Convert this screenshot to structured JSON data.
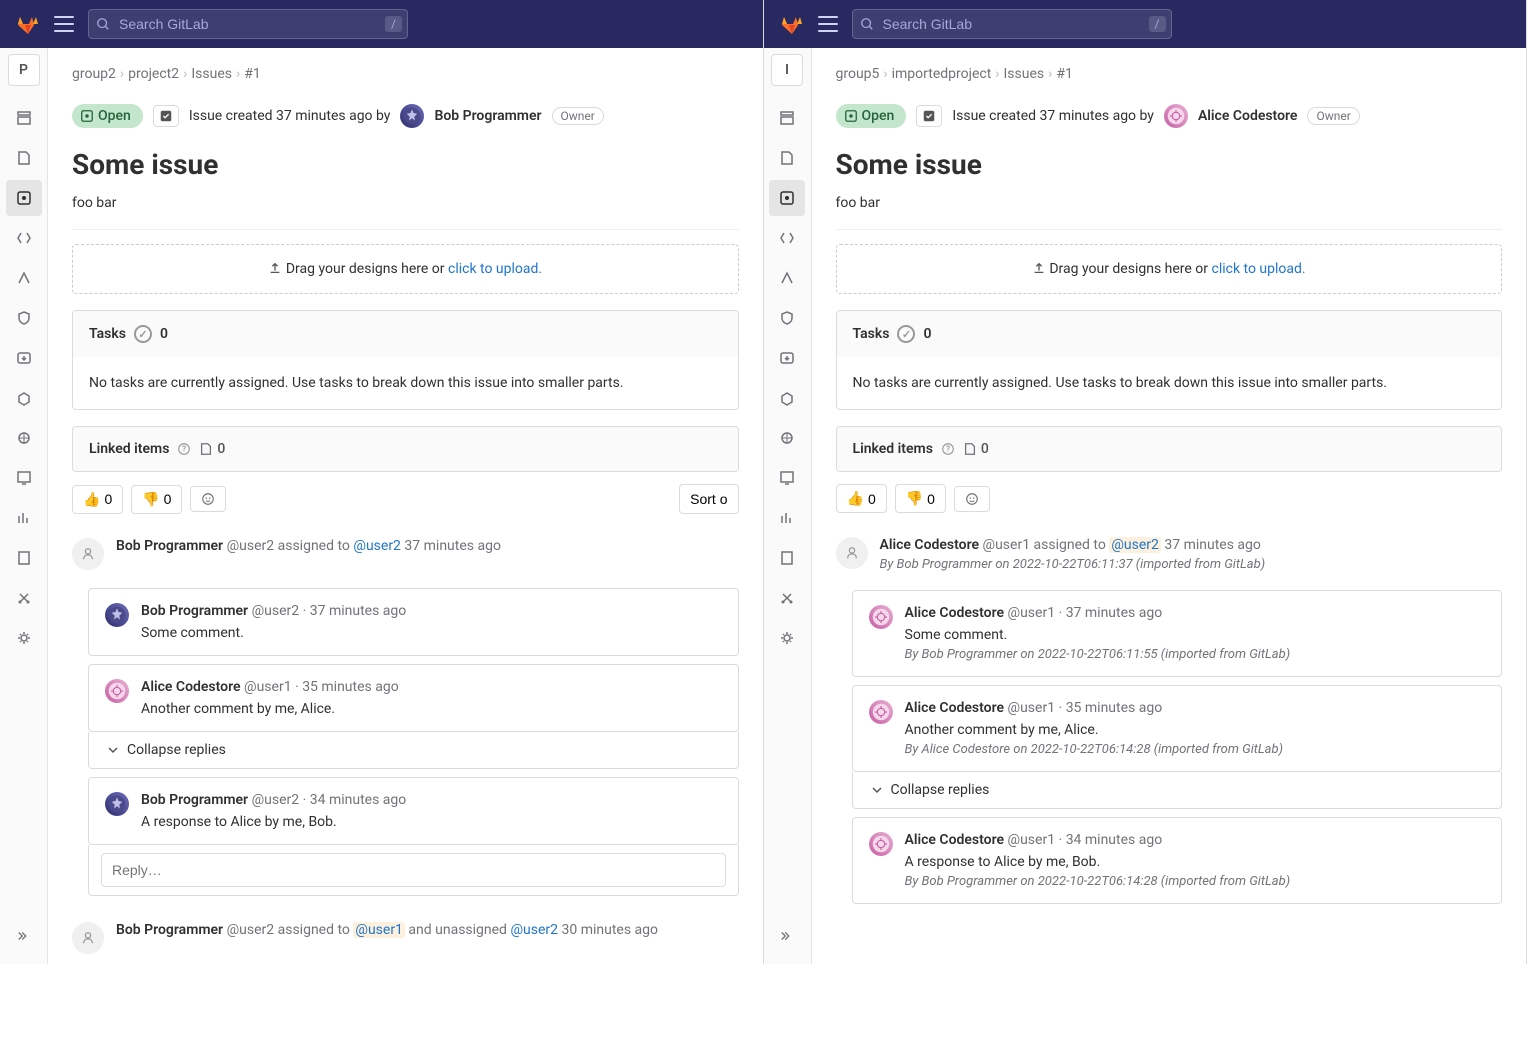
{
  "search_placeholder": "Search GitLab",
  "slash_key": "/",
  "panes": [
    {
      "project_initial": "P",
      "breadcrumbs": [
        "group2",
        "project2",
        "Issues",
        "#1"
      ],
      "status": "Open",
      "created_prefix": "Issue created 37 minutes ago by",
      "author": {
        "name": "Bob Programmer",
        "avatar": "bob"
      },
      "role": "Owner",
      "title": "Some issue",
      "desc": "foo bar",
      "upload_text": "Drag your designs here or ",
      "upload_link": "click to upload.",
      "tasks_label": "Tasks",
      "tasks_count": "0",
      "tasks_empty": "No tasks are currently assigned. Use tasks to break down this issue into smaller parts.",
      "linked_label": "Linked items",
      "linked_count": "0",
      "thumbs_up": "0",
      "thumbs_down": "0",
      "sort_label": "Sort o",
      "timeline": [
        {
          "type": "sys",
          "name": "Bob Programmer",
          "handle": "@user2",
          "text": " assigned to ",
          "mention": "@user2",
          "time": "37 minutes ago"
        },
        {
          "type": "note",
          "avatar": "bob",
          "name": "Bob Programmer",
          "handle": "@user2",
          "time": "37 minutes ago",
          "body": "Some comment."
        },
        {
          "type": "note",
          "avatar": "alice",
          "name": "Alice Codestore",
          "handle": "@user1",
          "time": "35 minutes ago",
          "body": "Another comment by me, Alice."
        },
        {
          "type": "collapse",
          "label": "Collapse replies"
        },
        {
          "type": "note",
          "avatar": "bob",
          "name": "Bob Programmer",
          "handle": "@user2",
          "time": "34 minutes ago",
          "body": "A response to Alice by me, Bob."
        },
        {
          "type": "reply",
          "placeholder": "Reply…"
        },
        {
          "type": "sys2",
          "name": "Bob Programmer",
          "handle": "@user2",
          "text1": " assigned to ",
          "m1": "@user1",
          "text2": " and unassigned ",
          "m2": "@user2",
          "time": "30 minutes ago"
        }
      ]
    },
    {
      "project_initial": "I",
      "breadcrumbs": [
        "group5",
        "importedproject",
        "Issues",
        "#1"
      ],
      "status": "Open",
      "created_prefix": "Issue created 37 minutes ago by",
      "author": {
        "name": "Alice Codestore",
        "avatar": "alice"
      },
      "role": "Owner",
      "title": "Some issue",
      "desc": "foo bar",
      "upload_text": "Drag your designs here or ",
      "upload_link": "click to upload.",
      "tasks_label": "Tasks",
      "tasks_count": "0",
      "tasks_empty": "No tasks are currently assigned. Use tasks to break down this issue into smaller parts.",
      "linked_label": "Linked items",
      "linked_count": "0",
      "thumbs_up": "0",
      "thumbs_down": "0",
      "sort_label": "",
      "timeline": [
        {
          "type": "sys",
          "name": "Alice Codestore",
          "handle": "@user1",
          "text": " assigned to ",
          "mention": "@user2",
          "hl": true,
          "time": "37 minutes ago",
          "import": "By Bob Programmer on 2022-10-22T06:11:37 (imported from GitLab)"
        },
        {
          "type": "note",
          "avatar": "alice",
          "name": "Alice Codestore",
          "handle": "@user1",
          "time": "37 minutes ago",
          "body": "Some comment.",
          "import": "By Bob Programmer on 2022-10-22T06:11:55 (imported from GitLab)"
        },
        {
          "type": "note",
          "avatar": "alice",
          "name": "Alice Codestore",
          "handle": "@user1",
          "time": "35 minutes ago",
          "body": "Another comment by me, Alice.",
          "import": "By Alice Codestore on 2022-10-22T06:14:28 (imported from GitLab)"
        },
        {
          "type": "collapse",
          "label": "Collapse replies"
        },
        {
          "type": "note",
          "avatar": "alice",
          "name": "Alice Codestore",
          "handle": "@user1",
          "time": "34 minutes ago",
          "body": "A response to Alice by me, Bob.",
          "import": "By Bob Programmer on 2022-10-22T06:14:28 (imported from GitLab)"
        }
      ]
    }
  ]
}
